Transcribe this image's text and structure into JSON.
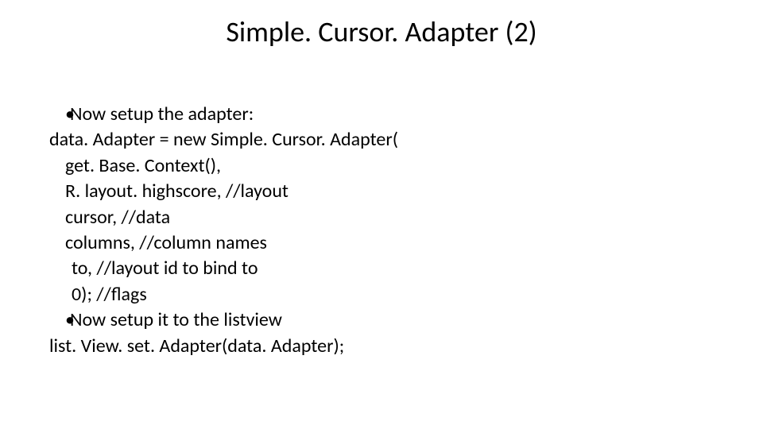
{
  "title": "Simple. Cursor. Adapter (2)",
  "bullets": {
    "b1": "Now setup the adapter:",
    "b2": "Now setup it to the listview"
  },
  "code": {
    "l1": "data. Adapter = new Simple. Cursor. Adapter(",
    "l2": "get. Base. Context(),",
    "l3": "R. layout. highscore,  //layout",
    "l4": "cursor,  //data",
    "l5": "columns,  //column names",
    "l6": "to,  //layout id to bind to",
    "l7": "0);  //flags",
    "l8": "list. View. set. Adapter(data. Adapter);"
  }
}
